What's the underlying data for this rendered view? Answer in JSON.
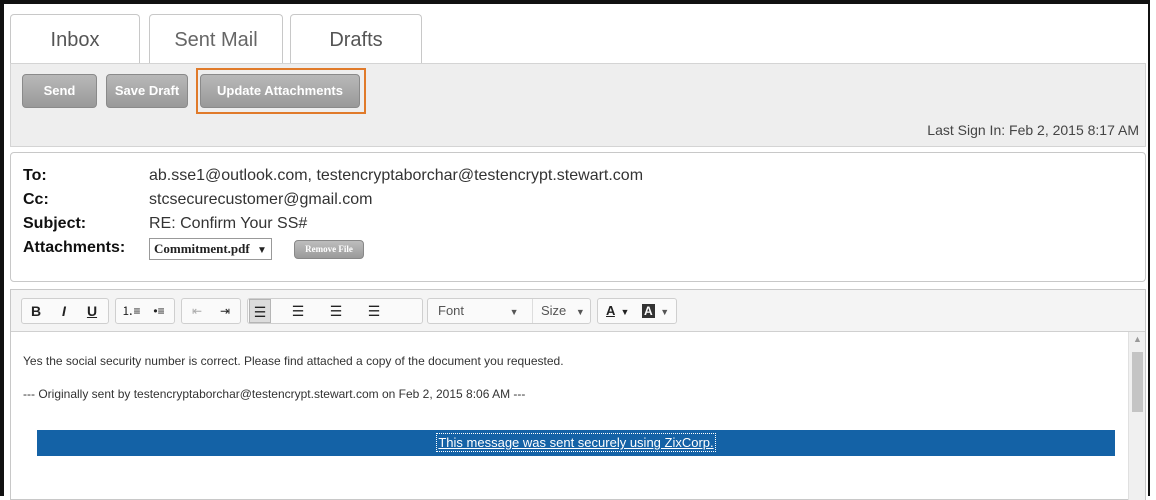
{
  "tabs": [
    {
      "label": "Inbox"
    },
    {
      "label": "Sent Mail"
    },
    {
      "label": "Drafts"
    }
  ],
  "toolbar": {
    "send_label": "Send",
    "save_draft_label": "Save Draft",
    "update_attachments_label": "Update Attachments",
    "last_sign_in": "Last Sign In: Feb 2, 2015 8:17 AM",
    "highlight_color": "#e07a2a"
  },
  "header": {
    "to_label": "To:",
    "to_value": "ab.sse1@outlook.com, testencryptaborchar@testencrypt.stewart.com",
    "cc_label": "Cc:",
    "cc_value": "stcsecurecustomer@gmail.com",
    "subject_label": "Subject:",
    "subject_value": "RE: Confirm Your SS#",
    "attachments_label": "Attachments:",
    "attachment_selected": "Commitment.pdf",
    "remove_file_label": "Remove File"
  },
  "editor_toolbar": {
    "bold": "B",
    "italic": "I",
    "underline": "U",
    "font_label": "Font",
    "size_label": "Size",
    "text_color_label": "A",
    "bg_color_label": "A"
  },
  "body": {
    "line1": "Yes the social security number is correct.  Please find attached a copy of the document you requested.",
    "line2": "--- Originally sent by testencryptaborchar@testencrypt.stewart.com on Feb 2, 2015 8:06 AM ---",
    "banner_link": "This message was sent securely using ZixCorp.",
    "banner_color": "#1462a6"
  }
}
